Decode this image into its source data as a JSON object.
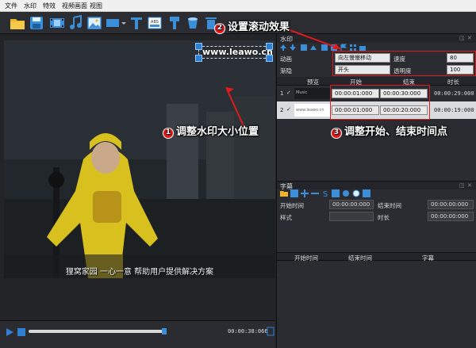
{
  "menubar": {
    "items": [
      "文件",
      "水印",
      "特效",
      "视频画面",
      "视图"
    ]
  },
  "toolbar": {
    "icons": [
      "folder-icon",
      "save-icon",
      "film-icon",
      "music-icon",
      "image-icon",
      "rectangle-icon",
      "text-icon",
      "subtitle-icon",
      "brush-icon",
      "bucket-icon",
      "trash-icon"
    ]
  },
  "preview": {
    "watermark_text": "www.leawo.cn",
    "caption_text": "狸窝家园 一心一意 帮助用户提供解决方案",
    "time": "00:00:38:066"
  },
  "watermark_panel": {
    "title": "水印",
    "anim_label": "动画",
    "anim_value": "向左慢慢移动",
    "speed_label": "速度",
    "speed_value": "80",
    "ease_label": "渐隐",
    "ease_value": "开头",
    "opacity_label": "透明度",
    "opacity_value": "100",
    "columns": [
      "预览",
      "开始",
      "结束",
      "时长"
    ],
    "rows": [
      {
        "index": "1",
        "check": "✓",
        "preview": "Music",
        "start": "00:00:01:000",
        "end": "00:00:30:000",
        "duration": "00:00:29:000"
      },
      {
        "index": "2",
        "check": "✓",
        "preview": "www.leawo.cn",
        "start": "00:00:01:000",
        "end": "00:00:20:000",
        "duration": "00:00:19:000"
      }
    ]
  },
  "subtitle_panel": {
    "title": "字幕",
    "start_label": "开始时间",
    "start_value": "00:00:00:000",
    "end_label": "结束时间",
    "end_value": "00:00:00:000",
    "style_label": "样式",
    "duration_label": "时长",
    "duration_value": "00:00:00:000",
    "columns": [
      "开始时间",
      "结束时间",
      "字幕"
    ]
  },
  "callouts": {
    "one": {
      "num": "1",
      "text": "调整水印大小位置"
    },
    "two": {
      "num": "2",
      "text": "设置滚动效果"
    },
    "three": {
      "num": "3",
      "text": "调整开始、结束时间点"
    }
  },
  "colors": {
    "accent_red": "#e01b1b",
    "accent_blue": "#2f7fd3",
    "panel_bg": "#2a2c31"
  }
}
